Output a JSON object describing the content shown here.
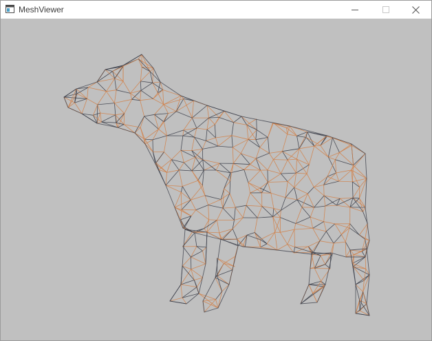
{
  "window": {
    "title": "MeshViewer",
    "app_icon": "app-window-icon",
    "controls": {
      "minimize_icon": "minimize-icon",
      "maximize_icon": "maximize-icon",
      "close_icon": "close-icon"
    }
  },
  "viewport": {
    "background_color": "#c0c0c0",
    "model": "cow",
    "render_mode": "wireframe",
    "edge_colors": [
      "#d2824a",
      "#3c3f4a"
    ]
  }
}
